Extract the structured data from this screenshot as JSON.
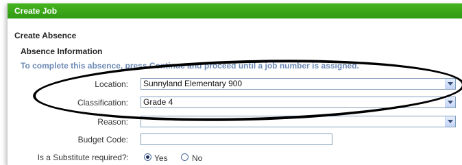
{
  "panel": {
    "title": "Create Job"
  },
  "section": {
    "heading": "Create Absence",
    "subheading": "Absence Information",
    "instruction": "To complete this absence, press Continue and proceed until a job number is assigned."
  },
  "fields": {
    "location": {
      "label": "Location:",
      "value": "Sunnyland Elementary 900"
    },
    "classification": {
      "label": "Classification:",
      "value": "Grade 4"
    },
    "reason": {
      "label": "Reason:",
      "value": ""
    },
    "budget_code": {
      "label": "Budget Code:",
      "value": ""
    },
    "substitute": {
      "label": "Is a Substitute required?:",
      "yes_label": "Yes",
      "no_label": "No",
      "selected": "Yes"
    }
  },
  "colors": {
    "header_green": "#3aa819",
    "instruction_blue": "#6d8ab5"
  }
}
